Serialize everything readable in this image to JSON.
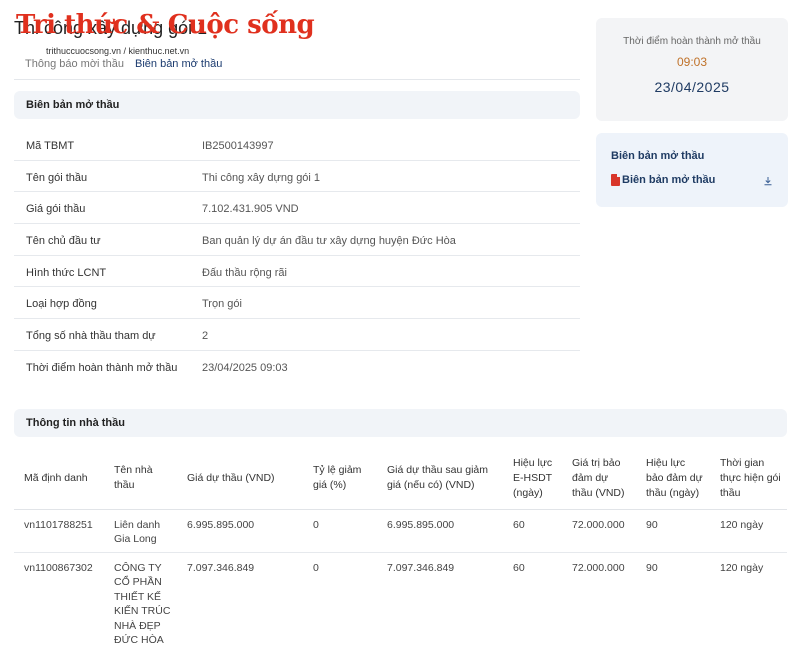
{
  "page": {
    "title": "Thi công xây dựng gói 1"
  },
  "watermark": {
    "logo": "Tri thức & Cuộc sống",
    "sub": "trithuccuocsong.vn / kienthuc.net.vn"
  },
  "tabs": [
    {
      "label": "Thông báo mời thầu",
      "active": false
    },
    {
      "label": "Biên bản mở thầu",
      "active": true
    }
  ],
  "section_opening": {
    "title": "Biên bản mở thầu"
  },
  "info_rows": [
    {
      "key": "Mã TBMT",
      "value": "IB2500143997"
    },
    {
      "key": "Tên gói thầu",
      "value": "Thi công xây dựng gói 1"
    },
    {
      "key": "Giá gói thầu",
      "value": "7.102.431.905 VND"
    },
    {
      "key": "Tên chủ đầu tư",
      "value": "Ban quản lý dự án đầu tư xây dựng huyện Đức Hòa"
    },
    {
      "key": "Hình thức LCNT",
      "value": "Đấu thầu rộng rãi"
    },
    {
      "key": "Loại hợp đồng",
      "value": "Trọn gói"
    },
    {
      "key": "Tổng số nhà thầu tham dự",
      "value": "2"
    },
    {
      "key": "Thời điểm hoàn thành mở thầu",
      "value": "23/04/2025 09:03"
    }
  ],
  "completion_card": {
    "label": "Thời điểm hoàn thành mở thầu",
    "time": "09:03",
    "date": "23/04/2025"
  },
  "download_card": {
    "title": "Biên bản mở thầu",
    "link": "Biên bản mở thầu",
    "icon": "download-icon"
  },
  "section_bidders": {
    "title": "Thông tin nhà thầu"
  },
  "bidders_table": {
    "headers": [
      "Mã định danh",
      "Tên nhà thầu",
      "Giá dự thầu (VND)",
      "Tỷ lệ giảm giá (%)",
      "Giá dự thầu sau giảm giá (nếu có) (VND)",
      "Hiệu lực E-HSDT (ngày)",
      "Giá trị bảo đảm dự thầu (VND)",
      "Hiệu lực bảo đảm dự thầu (ngày)",
      "Thời gian thực hiện gói thầu"
    ],
    "rows": [
      [
        "vn1101788251",
        "Liên danh Gia Long",
        "6.995.895.000",
        "0",
        "6.995.895.000",
        "60",
        "72.000.000",
        "90",
        "120 ngày"
      ],
      [
        "vn1100867302",
        "CÔNG TY CỔ PHẦN THIẾT KẾ KIẾN TRÚC NHÀ ĐẸP ĐỨC HÒA",
        "7.097.346.849",
        "0",
        "7.097.346.849",
        "60",
        "72.000.000",
        "90",
        "120 ngày"
      ]
    ]
  }
}
